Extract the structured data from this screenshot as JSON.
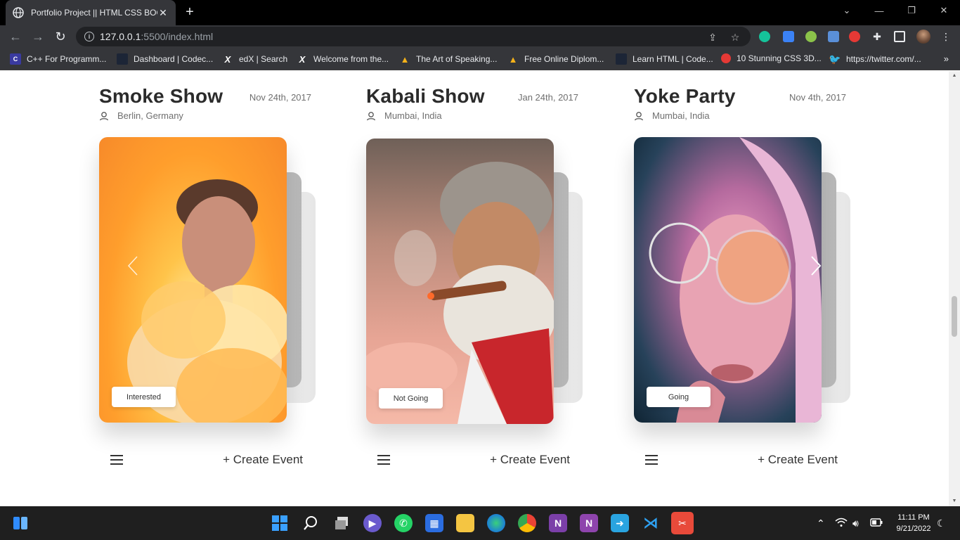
{
  "browser": {
    "tab_title": "Portfolio Project || HTML CSS BOO",
    "tab_close": "✕",
    "new_tab": "+",
    "url_host": "127.0.0.1",
    "url_path": ":5500/index.html",
    "bookmarks": [
      {
        "label": "C++ For Programm...",
        "icon": "codecademy-icon"
      },
      {
        "label": "Dashboard | Codec...",
        "icon": "codecademy-icon"
      },
      {
        "label": "edX | Search",
        "icon": "edx-icon"
      },
      {
        "label": "Welcome from the...",
        "icon": "edx-icon"
      },
      {
        "label": "The Art of Speaking...",
        "icon": "alison-icon"
      },
      {
        "label": "Free Online Diplom...",
        "icon": "alison-icon"
      },
      {
        "label": "Learn HTML | Code...",
        "icon": "codecademy-icon"
      },
      {
        "label": "10 Stunning CSS 3D...",
        "icon": "youtube-icon"
      },
      {
        "label": "https://twitter.com/...",
        "icon": "twitter-icon"
      }
    ],
    "more": "»"
  },
  "events": [
    {
      "title": "Smoke Show",
      "date": "Nov 24th, 2017",
      "location": "Berlin, Germany",
      "status": "Interested",
      "create": "+ Create Event"
    },
    {
      "title": "Kabali Show",
      "date": "Jan 24th, 2017",
      "location": "Mumbai, India",
      "status": "Not Going",
      "create": "+ Create Event"
    },
    {
      "title": "Yoke Party",
      "date": "Nov 4th, 2017",
      "location": "Mumbai, India",
      "status": "Going",
      "create": "+ Create Event"
    }
  ],
  "taskbar": {
    "time": "11:11 PM",
    "date": "9/21/2022"
  },
  "colors": {
    "chrome_dark": "#35363a",
    "title_text": "#2b2b2b",
    "muted_text": "#6f6f6f",
    "taskbar": "#1f1f1f"
  }
}
